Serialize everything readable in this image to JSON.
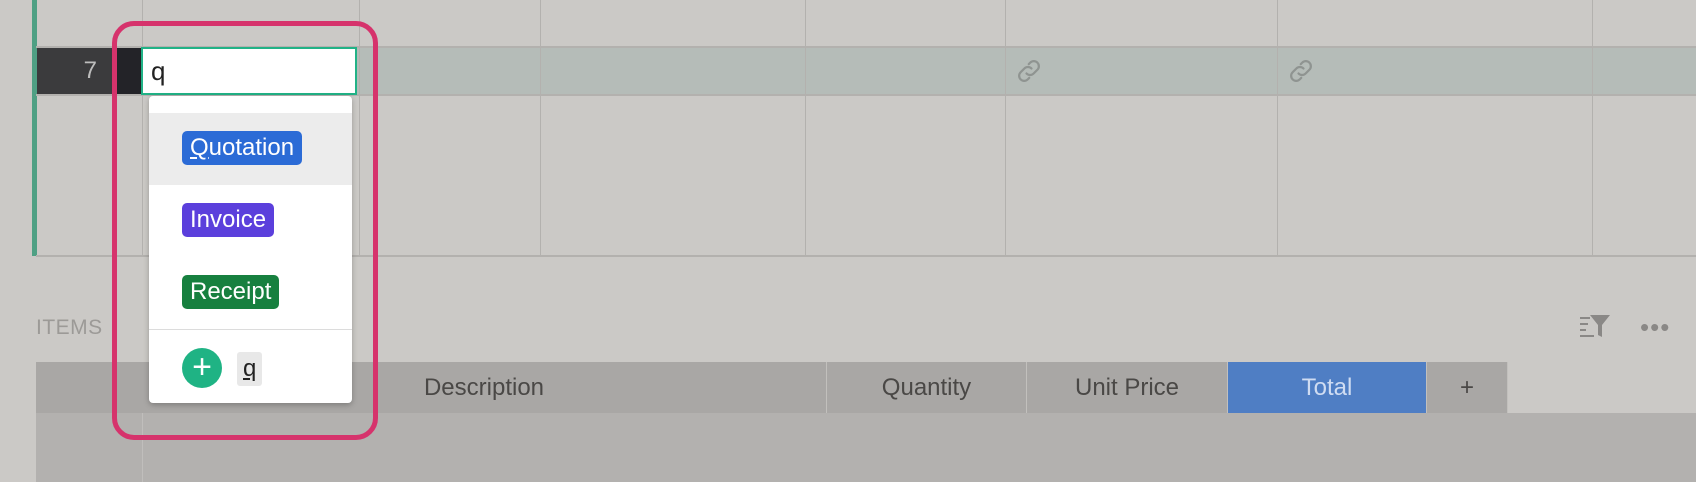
{
  "grid": {
    "row_number": "7"
  },
  "editor": {
    "value": "q"
  },
  "dropdown": {
    "options": [
      {
        "label": "Quotation",
        "color": "#2b6bd6"
      },
      {
        "label": "Invoice",
        "color": "#5b3fdc"
      },
      {
        "label": "Receipt",
        "color": "#17803f"
      }
    ],
    "add_text": "q",
    "add_icon": "plus-icon"
  },
  "section": {
    "title": "ITEMS",
    "filter_icon": "sort-filter-icon",
    "more_icon": "more-icon"
  },
  "table": {
    "columns": [
      "Description",
      "Quantity",
      "Unit Price",
      "Total",
      "+"
    ],
    "active_column": "Total"
  },
  "colors": {
    "accent": "#21b286",
    "highlight": "#d6336c",
    "selected_column": "#4f7ec4"
  }
}
